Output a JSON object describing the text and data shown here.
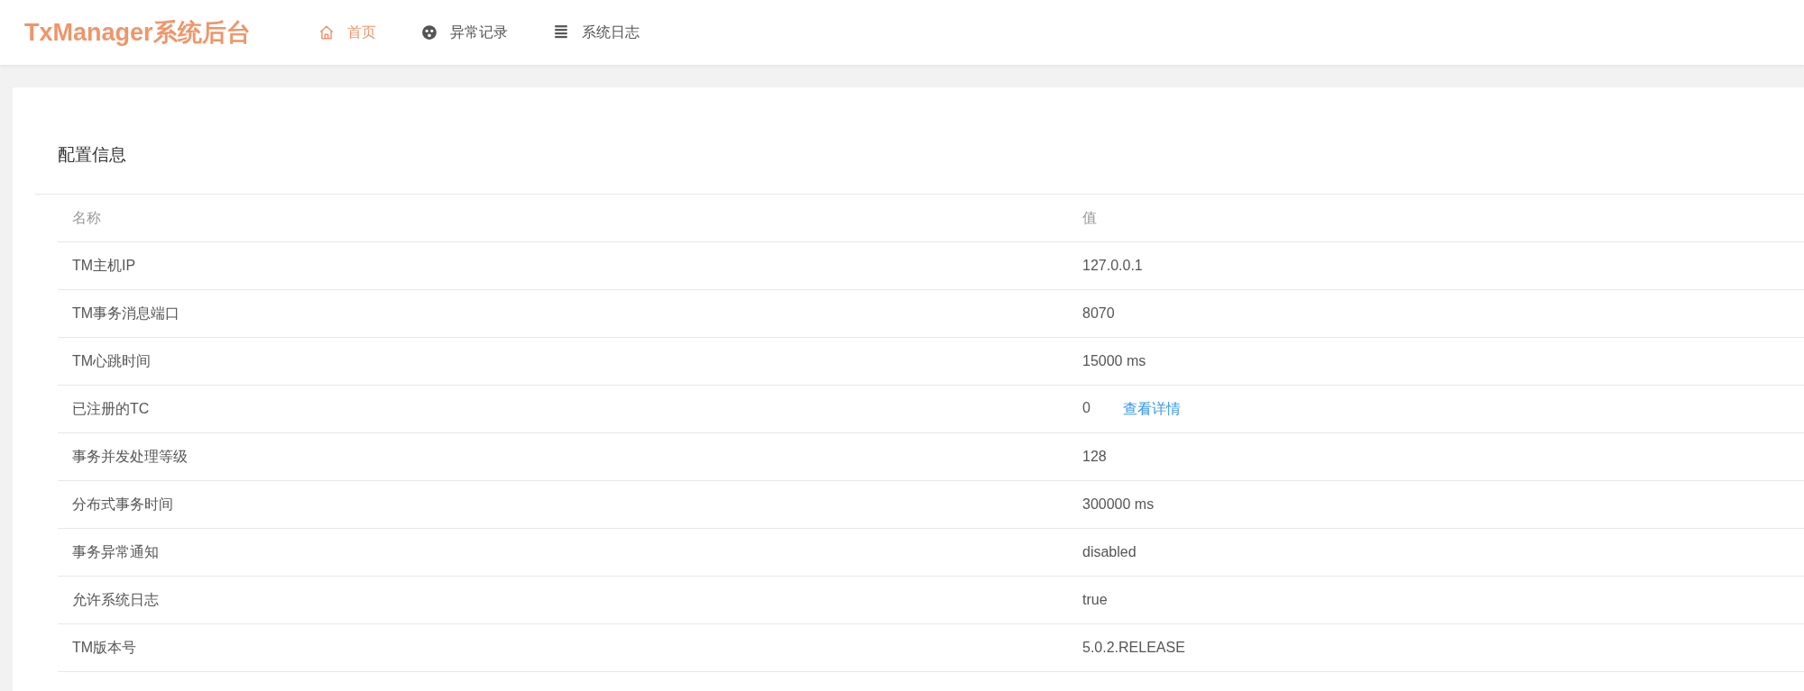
{
  "header": {
    "logo": "TxManager系统后台",
    "nav": [
      {
        "label": "首页",
        "kind": "home",
        "selected": true
      },
      {
        "label": "异常记录",
        "kind": "exception",
        "selected": false
      },
      {
        "label": "系统日志",
        "kind": "log",
        "selected": false
      }
    ]
  },
  "card": {
    "title": "配置信息",
    "table": {
      "columns": [
        "名称",
        "值"
      ],
      "rows": [
        {
          "name": "TM主机IP",
          "value": "127.0.0.1"
        },
        {
          "name": "TM事务消息端口",
          "value": "8070"
        },
        {
          "name": "TM心跳时间",
          "value": "15000 ms"
        },
        {
          "name": "已注册的TC",
          "value": "0",
          "link": "查看详情"
        },
        {
          "name": "事务并发处理等级",
          "value": "128"
        },
        {
          "name": "分布式事务时间",
          "value": "300000 ms"
        },
        {
          "name": "事务异常通知",
          "value": "disabled"
        },
        {
          "name": "允许系统日志",
          "value": "true"
        },
        {
          "name": "TM版本号",
          "value": "5.0.2.RELEASE"
        }
      ]
    }
  }
}
